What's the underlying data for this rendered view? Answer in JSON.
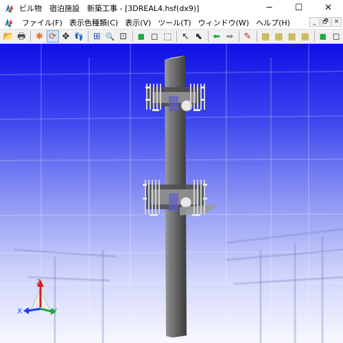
{
  "window": {
    "title": "ビル物　宿泊施設　新築工事 - [3DREAL4.hsf(dx9)]",
    "controls": {
      "minimize": "─",
      "maximize": "☐",
      "close": "✕"
    }
  },
  "menu": {
    "items": [
      "ファイル(F)",
      "表示色種類(C)",
      "表示(V)",
      "ツール(T)",
      "ウィンドウ(W)",
      "ヘルプ(H)"
    ],
    "mdi_controls": [
      "_",
      "🗗",
      "✕"
    ]
  },
  "toolbar": {
    "buttons": [
      {
        "name": "open-icon",
        "glyph": "📂"
      },
      {
        "name": "print-icon",
        "glyph": "🖶"
      },
      {
        "name": "paint-icon",
        "glyph": "✱"
      },
      {
        "name": "rotate-icon",
        "glyph": "⟳"
      },
      {
        "name": "pan-icon",
        "glyph": "✥"
      },
      {
        "name": "walk-icon",
        "glyph": "👣"
      },
      {
        "name": "grid-icon",
        "glyph": "⊞"
      },
      {
        "name": "zoom-in-icon",
        "glyph": "🔍"
      },
      {
        "name": "zoom-window-icon",
        "glyph": "⊡"
      },
      {
        "name": "cube-solid-icon",
        "glyph": "◼"
      },
      {
        "name": "cube-wire-icon",
        "glyph": "◻"
      },
      {
        "name": "cube-hidden-icon",
        "glyph": "⬚"
      },
      {
        "name": "select-arrow-icon",
        "glyph": "↖"
      },
      {
        "name": "select-box-icon",
        "glyph": "⬉"
      },
      {
        "name": "back-arrow-icon",
        "glyph": "⬅"
      },
      {
        "name": "forward-arrow-icon",
        "glyph": "➡"
      },
      {
        "name": "measure-icon",
        "glyph": "✎"
      },
      {
        "name": "layer-grid-1-icon",
        "glyph": "▦"
      },
      {
        "name": "layer-grid-2-icon",
        "glyph": "▦"
      },
      {
        "name": "layer-grid-3-icon",
        "glyph": "▦"
      },
      {
        "name": "layer-grid-4-icon",
        "glyph": "▦"
      },
      {
        "name": "cube-green-icon",
        "glyph": "◼"
      },
      {
        "name": "cube-outline-icon",
        "glyph": "◻"
      }
    ],
    "active_index": 3
  },
  "viewport": {
    "axis": {
      "z": "Z",
      "x": "X",
      "y": "Y"
    },
    "colors": {
      "top": "#1010e6",
      "bottom": "#f7f8ff",
      "column": "#5a5a5a",
      "axis_x": "#1a3cff",
      "axis_y": "#1fa83a",
      "axis_z": "#d21f1f"
    }
  }
}
